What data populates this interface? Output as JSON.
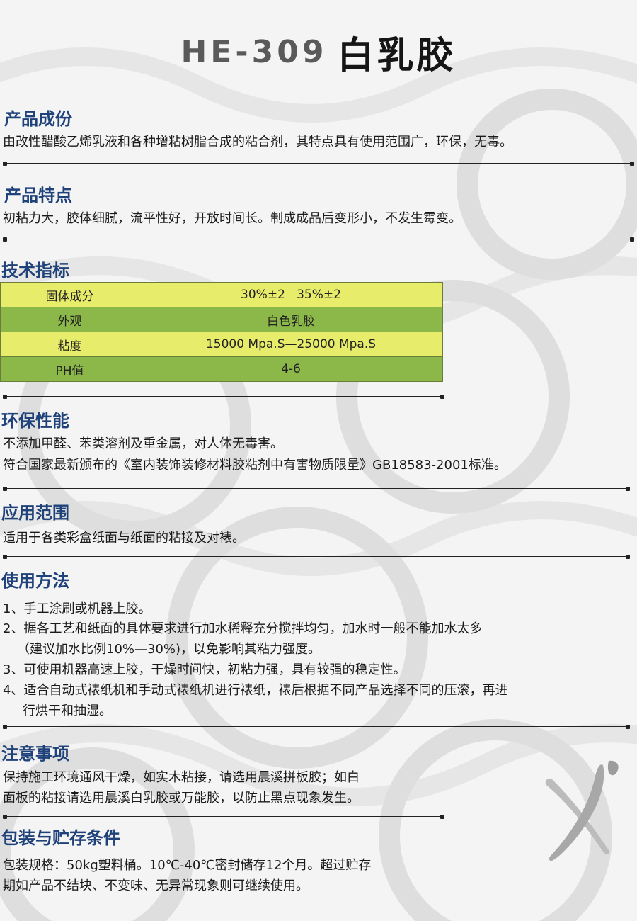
{
  "title": {
    "latin": "HE-309",
    "cn": "白乳胶"
  },
  "sections": {
    "composition": {
      "heading": "产品成份",
      "text": "由改性醋酸乙烯乳液和各种增粘树脂合成的粘合剂，其特点具有使用范围广，环保，无毒。"
    },
    "features": {
      "heading": "产品特点",
      "text": "初粘力大，胶体细腻，流平性好，开放时间长。制成成品后变形小，不发生霉变。"
    },
    "specs": {
      "heading": "技术指标",
      "rows": [
        {
          "label": "固体成分",
          "value": "30%±2   35%±2"
        },
        {
          "label": "外观",
          "value": "白色乳胶"
        },
        {
          "label": "粘度",
          "value": "15000 Mpa.S—25000 Mpa.S"
        },
        {
          "label": "PH值",
          "value": "4-6"
        }
      ]
    },
    "eco": {
      "heading": "环保性能",
      "lines": [
        "不添加甲醛、苯类溶剂及重金属，对人体无毒害。",
        "符合国家最新颁布的《室内装饰装修材料胶粘剂中有害物质限量》GB18583-2001标准。"
      ]
    },
    "application": {
      "heading": "应用范围",
      "text": "适用于各类彩盒纸面与纸面的粘接及对裱。"
    },
    "usage": {
      "heading": "使用方法",
      "lines": [
        "1、手工涂刷或机器上胶。",
        "2、据各工艺和纸面的具体要求进行加水稀释充分搅拌均匀，加水时一般不能加水太多",
        "（建议加水比例10%—30%)，以免影响其粘力强度。",
        "3、可使用机器高速上胶，干燥时间快，初粘力强，具有较强的稳定性。",
        "4、适合自动式裱纸机和手动式裱纸机进行裱纸，裱后根据不同产品选择不同的压滚，再进",
        "行烘干和抽湿。"
      ]
    },
    "notes": {
      "heading": "注意事项",
      "lines": [
        "保持施工环境通风干燥，如实木粘接，请选用晨溪拼板胶；如白",
        "面板的粘接请选用晨溪白乳胶或万能胶，以防止黑点现象发生。"
      ]
    },
    "storage": {
      "heading": "包装与贮存条件",
      "lines": [
        "包装规格：50kg塑料桶。10℃-40℃密封储存12个月。超过贮存",
        "期如产品不结块、不变味、无异常现象则可继续使用。"
      ]
    }
  },
  "colors": {
    "heading": "#20427a",
    "table_light": "#e7ec6a",
    "table_green": "#8bb848",
    "title_latin": "#5a5a5a"
  }
}
